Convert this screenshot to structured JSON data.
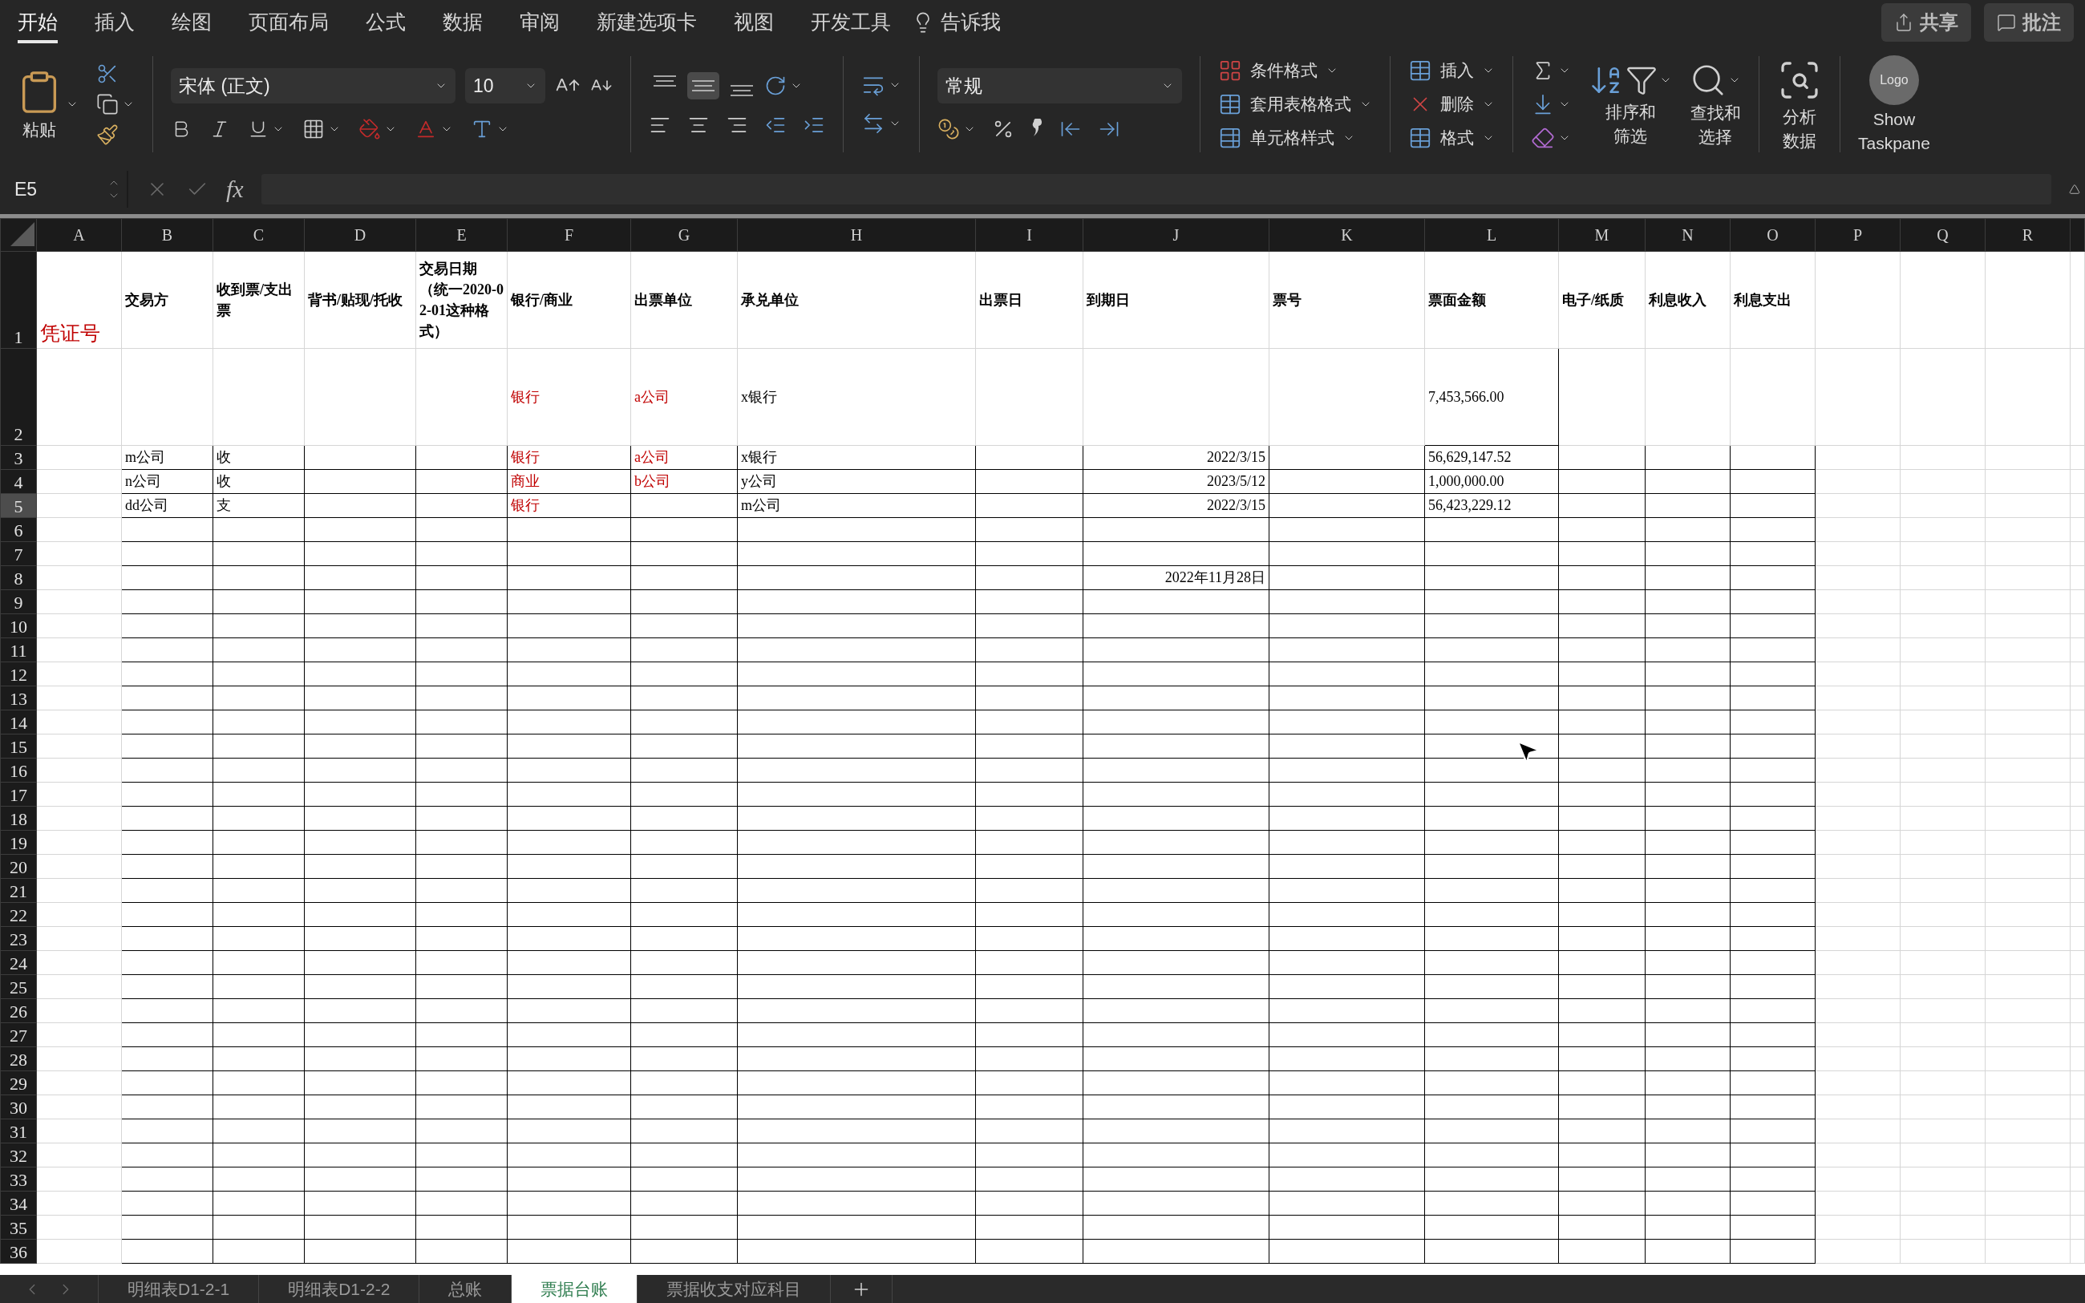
{
  "menu_tabs": [
    {
      "label": "开始",
      "selected": true
    },
    {
      "label": "插入",
      "selected": false
    },
    {
      "label": "绘图",
      "selected": false
    },
    {
      "label": "页面布局",
      "selected": false
    },
    {
      "label": "公式",
      "selected": false
    },
    {
      "label": "数据",
      "selected": false
    },
    {
      "label": "审阅",
      "selected": false
    },
    {
      "label": "新建选项卡",
      "selected": false
    },
    {
      "label": "视图",
      "selected": false
    },
    {
      "label": "开发工具",
      "selected": false
    }
  ],
  "tell_me": "告诉我",
  "share_button": "共享",
  "comments_button": "批注",
  "ribbon": {
    "paste_label": "粘贴",
    "font_name": "宋体 (正文)",
    "font_size": "10",
    "vertical_align_buttons": [
      {
        "selected": false
      },
      {
        "selected": true
      },
      {
        "selected": false
      }
    ],
    "number_format": "常规",
    "style_commands": [
      "条件格式",
      "套用表格格式",
      "单元格样式"
    ],
    "cell_commands": [
      "插入",
      "删除",
      "格式"
    ],
    "sort_filter_label": [
      "排序和",
      "筛选"
    ],
    "find_select_label": [
      "查找和",
      "选择"
    ],
    "analyze_label": [
      "分析",
      "数据"
    ],
    "taskpane_logo": "Logo",
    "taskpane_label": [
      "Show",
      "Taskpane"
    ]
  },
  "formula_bar": {
    "name_box": "E5",
    "function_label": "fx"
  },
  "columns": [
    "A",
    "B",
    "C",
    "D",
    "E",
    "F",
    "G",
    "H",
    "I",
    "J",
    "K",
    "L",
    "M",
    "N",
    "O",
    "P",
    "Q",
    "R"
  ],
  "rows": [
    {
      "number": "1",
      "selected": false,
      "cells": [
        {
          "kind": "title",
          "text": "凭证号",
          "color": "#c00000"
        },
        {
          "kind": "header",
          "text": "交易方",
          "color": "#000000"
        },
        {
          "kind": "header",
          "text": "收到票/支出票",
          "color": "#000000"
        },
        {
          "kind": "header",
          "text": "背书/贴现/托收",
          "color": "#000000"
        },
        {
          "kind": "header",
          "text": "交易日期（统一2020-02-01这种格式）",
          "color": "#000000"
        },
        {
          "kind": "header",
          "text": "银行/商业",
          "color": "#000000"
        },
        {
          "kind": "header",
          "text": "出票单位",
          "color": "#000000"
        },
        {
          "kind": "header",
          "text": "承兑单位",
          "color": "#000000"
        },
        {
          "kind": "header",
          "text": "出票日",
          "color": "#000000"
        },
        {
          "kind": "header",
          "text": "到期日",
          "color": "#000000"
        },
        {
          "kind": "header",
          "text": "票号",
          "color": "#000000"
        },
        {
          "kind": "header",
          "text": "票面金额",
          "color": "#000000"
        },
        {
          "kind": "header",
          "text": "电子/纸质",
          "color": "#000000"
        },
        {
          "kind": "header",
          "text": "利息收入",
          "color": "#000000"
        },
        {
          "kind": "header",
          "text": "利息支出",
          "color": "#000000"
        }
      ]
    },
    {
      "number": "2",
      "selected": false,
      "cells": [
        {
          "kind": "empty"
        },
        {
          "kind": "empty"
        },
        {
          "kind": "empty"
        },
        {
          "kind": "empty"
        },
        {
          "kind": "empty"
        },
        {
          "kind": "text",
          "text": "银行",
          "color": "#c00000"
        },
        {
          "kind": "text",
          "text": "a公司",
          "color": "#c00000"
        },
        {
          "kind": "text",
          "text": "x银行",
          "color": "#000000"
        },
        {
          "kind": "empty"
        },
        {
          "kind": "empty"
        },
        {
          "kind": "empty"
        },
        {
          "kind": "text",
          "text": "7,453,566.00",
          "color": "#000000"
        }
      ]
    },
    {
      "number": "3",
      "selected": false,
      "cells": [
        {
          "kind": "empty"
        },
        {
          "kind": "text",
          "text": "m公司",
          "color": "#000000"
        },
        {
          "kind": "text",
          "text": "收",
          "color": "#000000"
        },
        {
          "kind": "empty"
        },
        {
          "kind": "empty"
        },
        {
          "kind": "text",
          "text": "银行",
          "color": "#c00000"
        },
        {
          "kind": "text",
          "text": "a公司",
          "color": "#c00000"
        },
        {
          "kind": "text",
          "text": "x银行",
          "color": "#000000"
        },
        {
          "kind": "empty"
        },
        {
          "kind": "date",
          "text": "2022/3/15",
          "color": "#000000"
        },
        {
          "kind": "empty"
        },
        {
          "kind": "text",
          "text": "56,629,147.52",
          "color": "#000000"
        }
      ]
    },
    {
      "number": "4",
      "selected": false,
      "cells": [
        {
          "kind": "empty"
        },
        {
          "kind": "text",
          "text": "n公司",
          "color": "#000000"
        },
        {
          "kind": "text",
          "text": "收",
          "color": "#000000"
        },
        {
          "kind": "empty"
        },
        {
          "kind": "empty"
        },
        {
          "kind": "text",
          "text": "商业",
          "color": "#c00000"
        },
        {
          "kind": "text",
          "text": "b公司",
          "color": "#c00000"
        },
        {
          "kind": "text",
          "text": "y公司",
          "color": "#000000"
        },
        {
          "kind": "empty"
        },
        {
          "kind": "date",
          "text": "2023/5/12",
          "color": "#000000"
        },
        {
          "kind": "empty"
        },
        {
          "kind": "text",
          "text": "1,000,000.00",
          "color": "#000000"
        }
      ]
    },
    {
      "number": "5",
      "selected": true,
      "cells": [
        {
          "kind": "empty"
        },
        {
          "kind": "text",
          "text": "dd公司",
          "color": "#000000"
        },
        {
          "kind": "text",
          "text": "支",
          "color": "#000000"
        },
        {
          "kind": "empty"
        },
        {
          "kind": "empty"
        },
        {
          "kind": "text",
          "text": "银行",
          "color": "#c00000"
        },
        {
          "kind": "empty"
        },
        {
          "kind": "text",
          "text": "m公司",
          "color": "#000000"
        },
        {
          "kind": "empty"
        },
        {
          "kind": "date",
          "text": "2022/3/15",
          "color": "#000000"
        },
        {
          "kind": "empty"
        },
        {
          "kind": "text",
          "text": "56,423,229.12",
          "color": "#000000"
        }
      ]
    },
    {
      "number": "6",
      "selected": false
    },
    {
      "number": "7",
      "selected": false
    },
    {
      "number": "8",
      "selected": false,
      "cells": [
        {
          "kind": "empty"
        },
        {
          "kind": "empty"
        },
        {
          "kind": "empty"
        },
        {
          "kind": "empty"
        },
        {
          "kind": "empty"
        },
        {
          "kind": "empty"
        },
        {
          "kind": "empty"
        },
        {
          "kind": "empty"
        },
        {
          "kind": "empty"
        },
        {
          "kind": "date",
          "text": "2022年11月28日",
          "color": "#000000"
        }
      ]
    },
    {
      "number": "9",
      "selected": false
    },
    {
      "number": "10",
      "selected": false
    },
    {
      "number": "11",
      "selected": false
    },
    {
      "number": "12",
      "selected": false
    },
    {
      "number": "13",
      "selected": false
    },
    {
      "number": "14",
      "selected": false
    },
    {
      "number": "15",
      "selected": false
    },
    {
      "number": "16",
      "selected": false
    },
    {
      "number": "17",
      "selected": false
    },
    {
      "number": "18",
      "selected": false
    },
    {
      "number": "19",
      "selected": false
    },
    {
      "number": "20",
      "selected": false
    },
    {
      "number": "21",
      "selected": false
    },
    {
      "number": "22",
      "selected": false
    },
    {
      "number": "23",
      "selected": false
    },
    {
      "number": "24",
      "selected": false
    },
    {
      "number": "25",
      "selected": false
    },
    {
      "number": "26",
      "selected": false
    },
    {
      "number": "27",
      "selected": false
    },
    {
      "number": "28",
      "selected": false
    },
    {
      "number": "29",
      "selected": false
    },
    {
      "number": "30",
      "selected": false
    },
    {
      "number": "31",
      "selected": false
    },
    {
      "number": "32",
      "selected": false
    },
    {
      "number": "33",
      "selected": false
    },
    {
      "number": "34",
      "selected": false
    },
    {
      "number": "35",
      "selected": false
    },
    {
      "number": "36",
      "selected": false
    }
  ],
  "sheet_tabs": [
    {
      "label": "明细表D1-2-1",
      "selected": false
    },
    {
      "label": "明细表D1-2-2",
      "selected": false
    },
    {
      "label": "总账",
      "selected": false
    },
    {
      "label": "票据台账",
      "selected": true
    },
    {
      "label": "票据收支对应科目",
      "selected": false
    }
  ]
}
